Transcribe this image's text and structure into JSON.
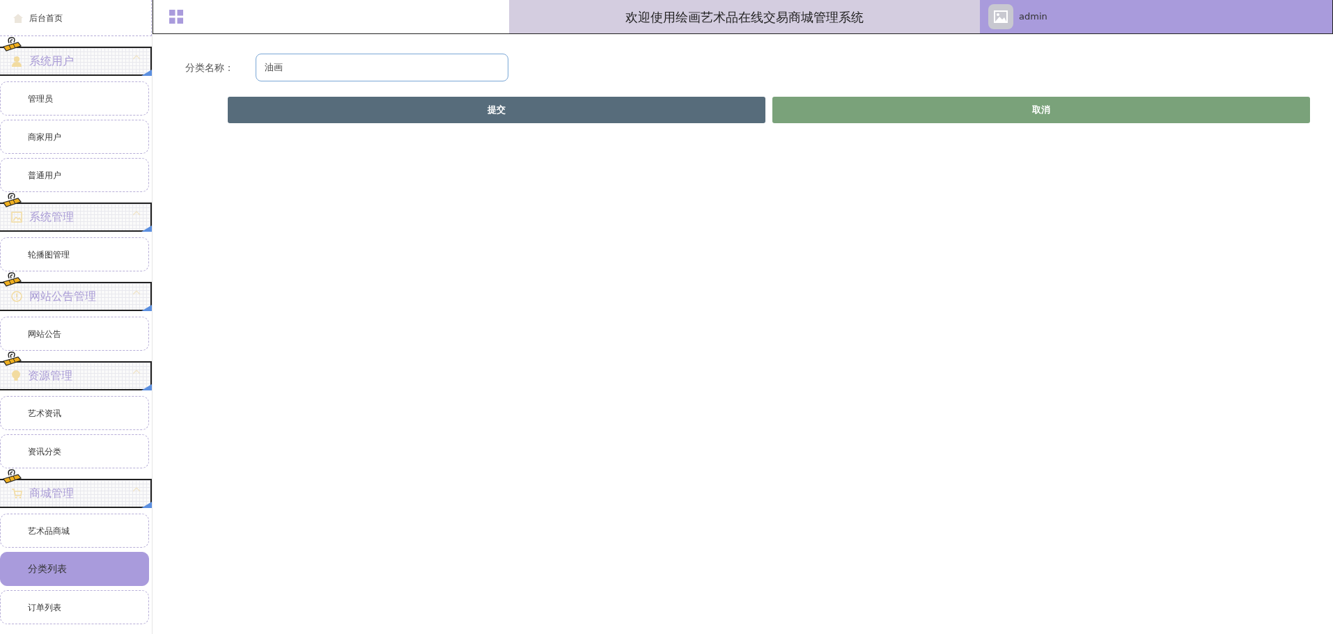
{
  "header": {
    "title": "欢迎使用绘画艺术品在线交易商城管理系统",
    "user": "admin"
  },
  "sidebar": {
    "home": {
      "label": "后台首页",
      "selected": false
    },
    "groups": [
      {
        "title": "系统用户",
        "expanded": true,
        "items": [
          {
            "label": "管理员",
            "selected": false
          },
          {
            "label": "商家用户",
            "selected": false
          },
          {
            "label": "普通用户",
            "selected": false
          }
        ]
      },
      {
        "title": "系统管理",
        "expanded": true,
        "items": [
          {
            "label": "轮播图管理",
            "selected": false
          }
        ]
      },
      {
        "title": "网站公告管理",
        "expanded": true,
        "items": [
          {
            "label": "网站公告",
            "selected": false
          }
        ]
      },
      {
        "title": "资源管理",
        "expanded": true,
        "items": [
          {
            "label": "艺术资讯",
            "selected": false
          },
          {
            "label": "资讯分类",
            "selected": false
          }
        ]
      },
      {
        "title": "商城管理",
        "expanded": true,
        "items": [
          {
            "label": "艺术品商城",
            "selected": false
          },
          {
            "label": "分类列表",
            "selected": true
          },
          {
            "label": "订单列表",
            "selected": false
          }
        ]
      }
    ]
  },
  "form": {
    "fields": [
      {
        "label": "分类名称：",
        "value": "油画"
      }
    ],
    "buttons": [
      {
        "label": "提交",
        "kind": "submit"
      },
      {
        "label": "取消",
        "kind": "cancel"
      }
    ]
  }
}
